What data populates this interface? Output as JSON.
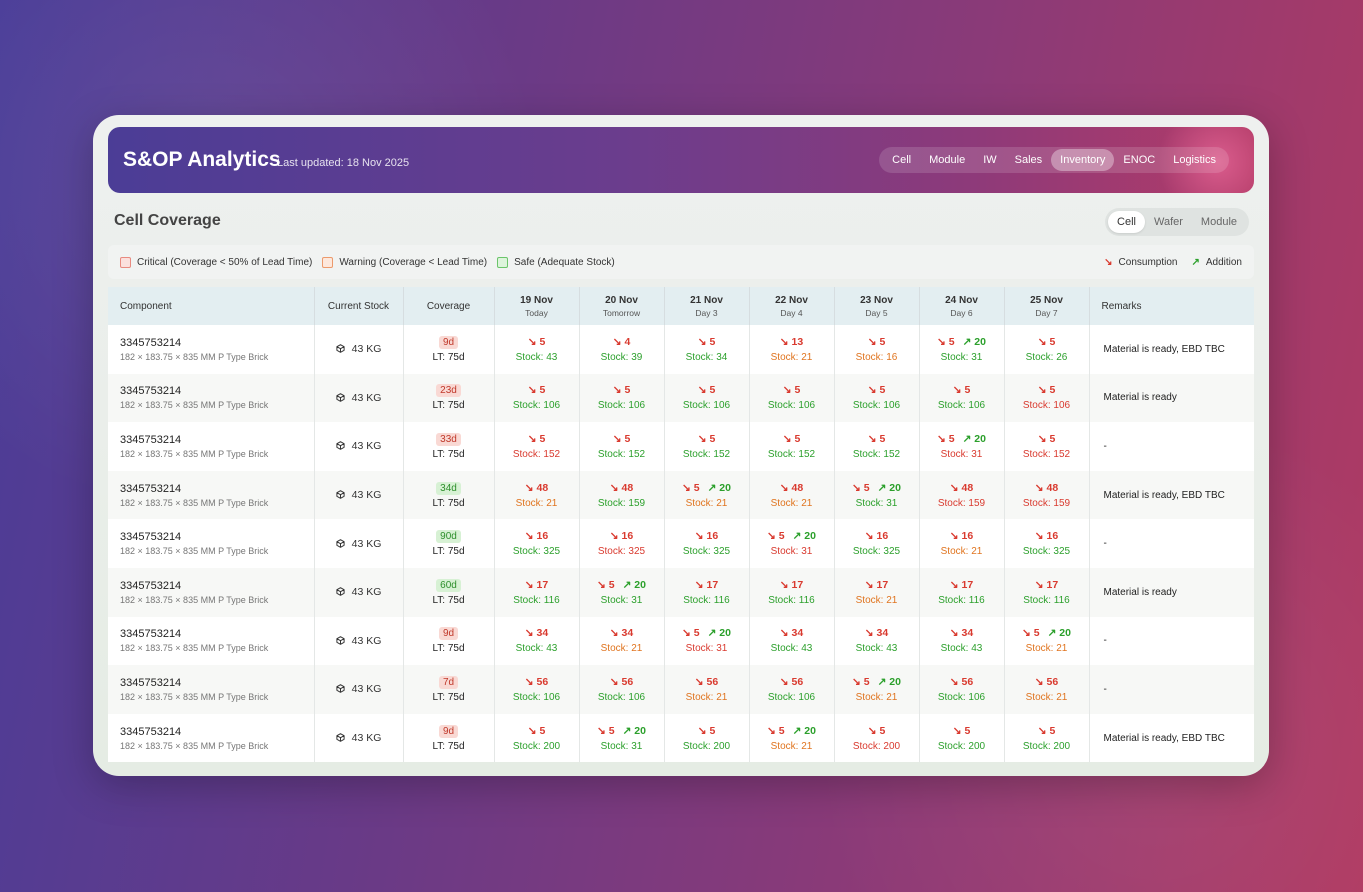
{
  "app": {
    "title": "S&OP Analytics",
    "last_updated": "Last updated: 18 Nov 2025"
  },
  "nav": [
    {
      "label": "Cell",
      "active": false
    },
    {
      "label": "Module",
      "active": false
    },
    {
      "label": "IW",
      "active": false
    },
    {
      "label": "Sales",
      "active": false
    },
    {
      "label": "Inventory",
      "active": true
    },
    {
      "label": "ENOC",
      "active": false
    },
    {
      "label": "Logistics",
      "active": false
    }
  ],
  "section": {
    "title": "Cell Coverage",
    "segments": [
      {
        "label": "Cell",
        "active": true
      },
      {
        "label": "Wafer",
        "active": false
      },
      {
        "label": "Module",
        "active": false
      }
    ]
  },
  "legend": {
    "critical": "Critical (Coverage < 50% of Lead Time)",
    "warning": "Warning (Coverage < Lead Time)",
    "safe": "Safe (Adequate Stock)",
    "consumption": "Consumption",
    "addition": "Addition"
  },
  "colors": {
    "critical": "#d93a2f",
    "warning": "#e0741f",
    "safe": "#2ca02c",
    "header_start": "#4b3d96",
    "header_end": "#b23b67"
  },
  "table": {
    "headers": {
      "component": "Component",
      "current_stock": "Current Stock",
      "coverage": "Coverage",
      "remarks": "Remarks"
    },
    "days": [
      {
        "date": "19 Nov",
        "label": "Today"
      },
      {
        "date": "20 Nov",
        "label": "Tomorrow"
      },
      {
        "date": "21 Nov",
        "label": "Day 3"
      },
      {
        "date": "22 Nov",
        "label": "Day 4"
      },
      {
        "date": "23 Nov",
        "label": "Day 5"
      },
      {
        "date": "24 Nov",
        "label": "Day 6"
      },
      {
        "date": "25 Nov",
        "label": "Day 7"
      }
    ],
    "rows": [
      {
        "id": "3345753214",
        "desc": "182 × 183.75 × 835 MM P Type Brick",
        "stock": "43 KG",
        "coverage": "9d",
        "coverage_status": "crit",
        "lt": "LT: 75d",
        "remarks": "Material is ready, EBD TBC",
        "days": [
          {
            "dn": "5",
            "up": "",
            "stock": "Stock: 43",
            "status": "safe"
          },
          {
            "dn": "4",
            "up": "",
            "stock": "Stock: 39",
            "status": "safe"
          },
          {
            "dn": "5",
            "up": "",
            "stock": "Stock: 34",
            "status": "safe"
          },
          {
            "dn": "13",
            "up": "",
            "stock": "Stock: 21",
            "status": "warn"
          },
          {
            "dn": "5",
            "up": "",
            "stock": "Stock: 16",
            "status": "warn"
          },
          {
            "dn": "5",
            "up": "20",
            "stock": "Stock: 31",
            "status": "safe"
          },
          {
            "dn": "5",
            "up": "",
            "stock": "Stock: 26",
            "status": "safe"
          }
        ]
      },
      {
        "id": "3345753214",
        "desc": "182 × 183.75 × 835 MM P Type Brick",
        "stock": "43 KG",
        "coverage": "23d",
        "coverage_status": "crit",
        "lt": "LT: 75d",
        "remarks": "Material is ready",
        "days": [
          {
            "dn": "5",
            "up": "",
            "stock": "Stock: 106",
            "status": "safe"
          },
          {
            "dn": "5",
            "up": "",
            "stock": "Stock: 106",
            "status": "safe"
          },
          {
            "dn": "5",
            "up": "",
            "stock": "Stock: 106",
            "status": "safe"
          },
          {
            "dn": "5",
            "up": "",
            "stock": "Stock: 106",
            "status": "safe"
          },
          {
            "dn": "5",
            "up": "",
            "stock": "Stock: 106",
            "status": "safe"
          },
          {
            "dn": "5",
            "up": "",
            "stock": "Stock: 106",
            "status": "safe"
          },
          {
            "dn": "5",
            "up": "",
            "stock": "Stock: 106",
            "status": "crit"
          }
        ]
      },
      {
        "id": "3345753214",
        "desc": "182 × 183.75 × 835 MM P Type Brick",
        "stock": "43 KG",
        "coverage": "33d",
        "coverage_status": "crit",
        "lt": "LT: 75d",
        "remarks": "-",
        "days": [
          {
            "dn": "5",
            "up": "",
            "stock": "Stock: 152",
            "status": "crit"
          },
          {
            "dn": "5",
            "up": "",
            "stock": "Stock: 152",
            "status": "safe"
          },
          {
            "dn": "5",
            "up": "",
            "stock": "Stock: 152",
            "status": "safe"
          },
          {
            "dn": "5",
            "up": "",
            "stock": "Stock: 152",
            "status": "safe"
          },
          {
            "dn": "5",
            "up": "",
            "stock": "Stock: 152",
            "status": "safe"
          },
          {
            "dn": "5",
            "up": "20",
            "stock": "Stock: 31",
            "status": "crit"
          },
          {
            "dn": "5",
            "up": "",
            "stock": "Stock: 152",
            "status": "crit"
          }
        ]
      },
      {
        "id": "3345753214",
        "desc": "182 × 183.75 × 835 MM P Type Brick",
        "stock": "43 KG",
        "coverage": "34d",
        "coverage_status": "safe",
        "lt": "LT: 75d",
        "remarks": "Material is ready, EBD TBC",
        "days": [
          {
            "dn": "48",
            "up": "",
            "stock": "Stock: 21",
            "status": "warn"
          },
          {
            "dn": "48",
            "up": "",
            "stock": "Stock: 159",
            "status": "safe"
          },
          {
            "dn": "5",
            "up": "20",
            "stock": "Stock: 21",
            "status": "warn"
          },
          {
            "dn": "48",
            "up": "",
            "stock": "Stock: 21",
            "status": "warn"
          },
          {
            "dn": "5",
            "up": "20",
            "stock": "Stock: 31",
            "status": "safe"
          },
          {
            "dn": "48",
            "up": "",
            "stock": "Stock: 159",
            "status": "crit"
          },
          {
            "dn": "48",
            "up": "",
            "stock": "Stock: 159",
            "status": "crit"
          }
        ]
      },
      {
        "id": "3345753214",
        "desc": "182 × 183.75 × 835 MM P Type Brick",
        "stock": "43 KG",
        "coverage": "90d",
        "coverage_status": "safe",
        "lt": "LT: 75d",
        "remarks": "-",
        "days": [
          {
            "dn": "16",
            "up": "",
            "stock": "Stock: 325",
            "status": "safe"
          },
          {
            "dn": "16",
            "up": "",
            "stock": "Stock: 325",
            "status": "crit"
          },
          {
            "dn": "16",
            "up": "",
            "stock": "Stock: 325",
            "status": "safe"
          },
          {
            "dn": "5",
            "up": "20",
            "stock": "Stock: 31",
            "status": "crit"
          },
          {
            "dn": "16",
            "up": "",
            "stock": "Stock: 325",
            "status": "safe"
          },
          {
            "dn": "16",
            "up": "",
            "stock": "Stock: 21",
            "status": "warn"
          },
          {
            "dn": "16",
            "up": "",
            "stock": "Stock: 325",
            "status": "safe"
          }
        ]
      },
      {
        "id": "3345753214",
        "desc": "182 × 183.75 × 835 MM P Type Brick",
        "stock": "43 KG",
        "coverage": "60d",
        "coverage_status": "safe",
        "lt": "LT: 75d",
        "remarks": "Material is ready",
        "days": [
          {
            "dn": "17",
            "up": "",
            "stock": "Stock: 116",
            "status": "safe"
          },
          {
            "dn": "5",
            "up": "20",
            "stock": "Stock: 31",
            "status": "safe"
          },
          {
            "dn": "17",
            "up": "",
            "stock": "Stock: 116",
            "status": "safe"
          },
          {
            "dn": "17",
            "up": "",
            "stock": "Stock: 116",
            "status": "safe"
          },
          {
            "dn": "17",
            "up": "",
            "stock": "Stock: 21",
            "status": "warn"
          },
          {
            "dn": "17",
            "up": "",
            "stock": "Stock: 116",
            "status": "safe"
          },
          {
            "dn": "17",
            "up": "",
            "stock": "Stock: 116",
            "status": "safe"
          }
        ]
      },
      {
        "id": "3345753214",
        "desc": "182 × 183.75 × 835 MM P Type Brick",
        "stock": "43 KG",
        "coverage": "9d",
        "coverage_status": "crit",
        "lt": "LT: 75d",
        "remarks": "-",
        "days": [
          {
            "dn": "34",
            "up": "",
            "stock": "Stock: 43",
            "status": "safe"
          },
          {
            "dn": "34",
            "up": "",
            "stock": "Stock: 21",
            "status": "warn"
          },
          {
            "dn": "5",
            "up": "20",
            "stock": "Stock: 31",
            "status": "crit"
          },
          {
            "dn": "34",
            "up": "",
            "stock": "Stock: 43",
            "status": "safe"
          },
          {
            "dn": "34",
            "up": "",
            "stock": "Stock: 43",
            "status": "safe"
          },
          {
            "dn": "34",
            "up": "",
            "stock": "Stock: 43",
            "status": "safe"
          },
          {
            "dn": "5",
            "up": "20",
            "stock": "Stock: 21",
            "status": "warn"
          }
        ]
      },
      {
        "id": "3345753214",
        "desc": "182 × 183.75 × 835 MM P Type Brick",
        "stock": "43 KG",
        "coverage": "7d",
        "coverage_status": "crit",
        "lt": "LT: 75d",
        "remarks": "-",
        "days": [
          {
            "dn": "56",
            "up": "",
            "stock": "Stock: 106",
            "status": "safe"
          },
          {
            "dn": "56",
            "up": "",
            "stock": "Stock: 106",
            "status": "safe"
          },
          {
            "dn": "56",
            "up": "",
            "stock": "Stock: 21",
            "status": "warn"
          },
          {
            "dn": "56",
            "up": "",
            "stock": "Stock: 106",
            "status": "safe"
          },
          {
            "dn": "5",
            "up": "20",
            "stock": "Stock: 21",
            "status": "warn"
          },
          {
            "dn": "56",
            "up": "",
            "stock": "Stock: 106",
            "status": "safe"
          },
          {
            "dn": "56",
            "up": "",
            "stock": "Stock: 21",
            "status": "warn"
          }
        ]
      },
      {
        "id": "3345753214",
        "desc": "182 × 183.75 × 835 MM P Type Brick",
        "stock": "43 KG",
        "coverage": "9d",
        "coverage_status": "crit",
        "lt": "LT: 75d",
        "remarks": "Material is ready, EBD TBC",
        "days": [
          {
            "dn": "5",
            "up": "",
            "stock": "Stock: 200",
            "status": "safe"
          },
          {
            "dn": "5",
            "up": "20",
            "stock": "Stock: 31",
            "status": "safe"
          },
          {
            "dn": "5",
            "up": "",
            "stock": "Stock: 200",
            "status": "safe"
          },
          {
            "dn": "5",
            "up": "20",
            "stock": "Stock: 21",
            "status": "warn"
          },
          {
            "dn": "5",
            "up": "",
            "stock": "Stock: 200",
            "status": "crit"
          },
          {
            "dn": "5",
            "up": "",
            "stock": "Stock: 200",
            "status": "safe"
          },
          {
            "dn": "5",
            "up": "",
            "stock": "Stock: 200",
            "status": "safe"
          }
        ]
      }
    ]
  }
}
